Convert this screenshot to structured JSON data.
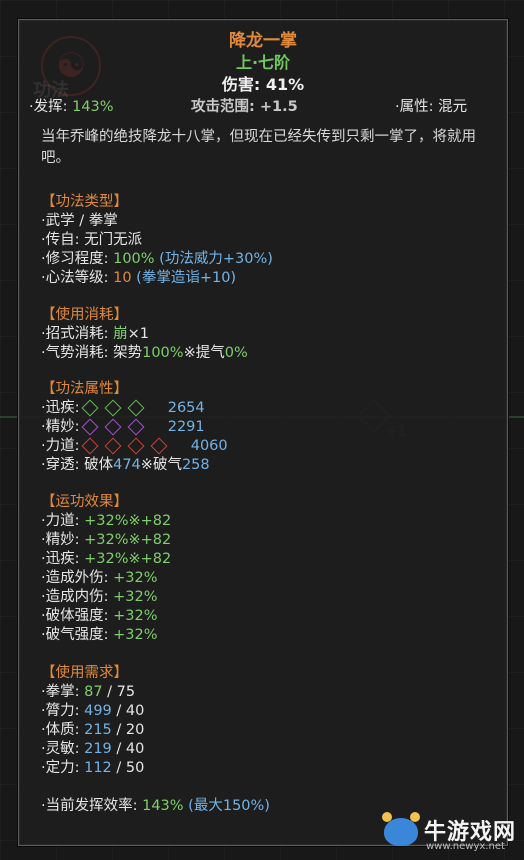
{
  "skill": {
    "name": "降龙一掌",
    "grade": "上·七阶",
    "damage": "伤害: 41%",
    "emblem": "☯",
    "ghost_title": "功法"
  },
  "stats_row": {
    "fahui_label": "·发挥: ",
    "fahui_value": "143%",
    "range_label": "攻击范围: ",
    "range_value": "+1.5",
    "attr_label": "·属性: ",
    "attr_value": "混元"
  },
  "description": "当年乔峰的绝技降龙十八掌，但现在已经失传到只剩一掌了，将就用吧。",
  "type_section": {
    "header": "【功法类型】",
    "category": "·武学 / 拳掌",
    "origin": "·传自: 无门无派",
    "mastery_label": "·修习程度: ",
    "mastery_value": "100%",
    "mastery_bonus": " (功法威力+30%)",
    "level_label": "·心法等级: ",
    "level_value": "10",
    "level_bonus": " (拳掌造诣+10)"
  },
  "cost_section": {
    "header": "【使用消耗】",
    "move_label": "·招式消耗: ",
    "move_value": "崩",
    "move_count": "×1",
    "qi_label": "·气势消耗: 架势",
    "qi_value1": "100%",
    "qi_sep": "※提气",
    "qi_value2": "0%"
  },
  "attr_section": {
    "header": "【功法属性】",
    "rows": [
      {
        "label": "·迅疾: ",
        "value": "2654",
        "color": "#5fbf4f",
        "diamonds": 3
      },
      {
        "label": "·精妙: ",
        "value": "2291",
        "color": "#a64fd6",
        "diamonds": 3
      },
      {
        "label": "·力道: ",
        "value": "4060",
        "color": "#c8443a",
        "diamonds": 4
      }
    ],
    "pierce_label": "·穿透: 破体",
    "pierce_v1": "474",
    "pierce_sep": "※破气",
    "pierce_v2": "258"
  },
  "effect_section": {
    "header": "【运功效果】",
    "rows": [
      {
        "label": "·力道: ",
        "value": "+32%※+82"
      },
      {
        "label": "·精妙: ",
        "value": "+32%※+82"
      },
      {
        "label": "·迅疾: ",
        "value": "+32%※+82"
      },
      {
        "label": "·造成外伤: ",
        "value": "+32%"
      },
      {
        "label": "·造成内伤: ",
        "value": "+32%"
      },
      {
        "label": "·破体强度: ",
        "value": "+32%"
      },
      {
        "label": "·破气强度: ",
        "value": "+32%"
      }
    ]
  },
  "req_section": {
    "header": "【使用需求】",
    "rows": [
      {
        "label": "·拳掌: ",
        "have": "87",
        "need": " / 75"
      },
      {
        "label": "·膂力: ",
        "have": "499",
        "need": " / 40"
      },
      {
        "label": "·体质: ",
        "have": "215",
        "need": " / 20"
      },
      {
        "label": "·灵敏: ",
        "have": "219",
        "need": " / 40"
      },
      {
        "label": "·定力: ",
        "have": "112",
        "need": " / 50"
      }
    ]
  },
  "efficiency": {
    "label": "·当前发挥效率: ",
    "value": "143%",
    "max": " (最大150%)"
  },
  "background": {
    "plus_text": "+1"
  },
  "watermark": {
    "name": "牛游戏网",
    "url": "www.newyx.net"
  }
}
